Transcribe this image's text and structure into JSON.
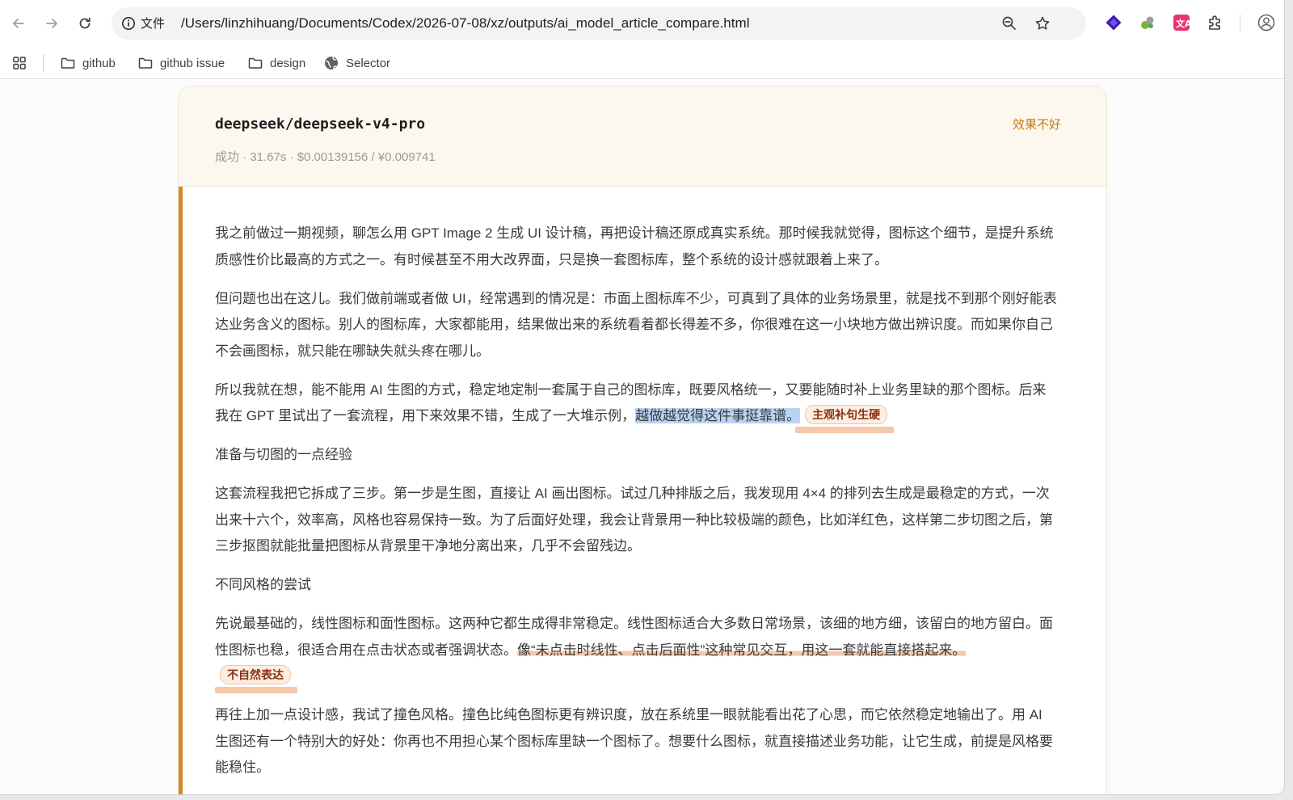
{
  "browser": {
    "info_label": "文件",
    "url": "/Users/linzhihuang/Documents/Codex/2026-07-08/xz/outputs/ai_model_article_compare.html",
    "bookmarks": [
      {
        "label": "github",
        "icon": "folder-icon"
      },
      {
        "label": "github issue",
        "icon": "folder-icon"
      },
      {
        "label": "design",
        "icon": "folder-icon"
      },
      {
        "label": "Selector",
        "icon": "globe-icon"
      }
    ]
  },
  "card": {
    "model": "deepseek/deepseek-v4-pro",
    "meta": "成功 · 31.67s · $0.00139156 / ¥0.009741",
    "verdict": "效果不好",
    "accent_color": "#d3892a"
  },
  "article": {
    "p1": "我之前做过一期视频，聊怎么用 GPT Image 2 生成 UI 设计稿，再把设计稿还原成真实系统。那时候我就觉得，图标这个细节，是提升系统质感性价比最高的方式之一。有时候甚至不用大改界面，只是换一套图标库，整个系统的设计感就跟着上来了。",
    "p2": "但问题也出在这儿。我们做前端或者做 UI，经常遇到的情况是：市面上图标库不少，可真到了具体的业务场景里，就是找不到那个刚好能表达业务含义的图标。别人的图标库，大家都能用，结果做出来的系统看着都长得差不多，你很难在这一小块地方做出辨识度。而如果你自己不会画图标，就只能在哪缺失就头疼在哪儿。",
    "p3_before": "所以我就在想，能不能用 AI 生图的方式，稳定地定制一套属于自己的图标库，既要风格统一，又要能随时补上业务里缺的那个图标。后来我在 GPT 里试出了一套流程，用下来效果不错，生成了一大堆示例，",
    "p3_highlight": "越做越觉得这件事挺靠谱。",
    "p3_tag": "主观补句生硬",
    "h1": "准备与切图的一点经验",
    "p4": "这套流程我把它拆成了三步。第一步是生图，直接让 AI 画出图标。试过几种排版之后，我发现用 4×4 的排列去生成是最稳定的方式，一次出来十六个，效率高，风格也容易保持一致。为了后面好处理，我会让背景用一种比较极端的颜色，比如洋红色，这样第二步切图之后，第三步抠图就能批量把图标从背景里干净地分离出来，几乎不会留残边。",
    "h2": "不同风格的尝试",
    "p5_before": "先说最基础的，线性图标和面性图标。这两种它都生成得非常稳定。线性图标适合大多数日常场景，该细的地方细，该留白的地方留白。面性图标也稳，很适合用在点击状态或者强调状态。",
    "p5_highlight": "像“未点击时线性、点击后面性”这种常见交互，用这一套就能直接搭起来。",
    "p5_tag": "不自然表达",
    "p6": "再往上加一点设计感，我试了撞色风格。撞色比纯色图标更有辨识度，放在系统里一眼就能看出花了心思，而它依然稳定地输出了。用 AI 生图还有一个特别大的好处：你再也不用担心某个图标库里缺一个图标了。想要什么图标，就直接描述业务功能，让它生成，前提是风格要能稳住。"
  }
}
